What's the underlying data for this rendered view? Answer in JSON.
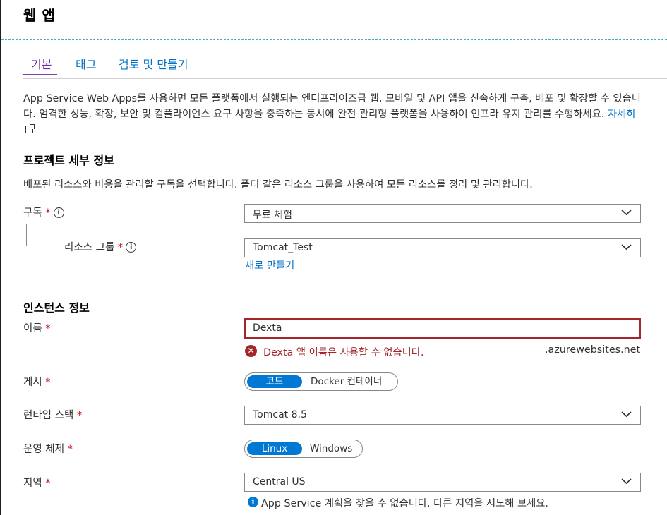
{
  "header": {
    "title": "웹 앱"
  },
  "tabs": [
    {
      "label": "기본",
      "active": true
    },
    {
      "label": "태그",
      "active": false
    },
    {
      "label": "검토 및 만들기",
      "active": false
    }
  ],
  "intro": {
    "text": "App Service Web Apps를 사용하면 모든 플랫폼에서 실행되는 엔터프라이즈급 웹, 모바일 및 API 앱을 신속하게 구축, 배포 및 확장할 수 있습니다. 엄격한 성능, 확장, 보안 및 컴플라이언스 요구 사항을 충족하는 동시에 완전 관리형 플랫폼을 사용하여 인프라 유지 관리를 수행하세요.",
    "learn_more": "자세히"
  },
  "project": {
    "title": "프로젝트 세부 정보",
    "description": "배포된 리소스와 비용을 관리할 구독을 선택합니다. 폴더 같은 리소스 그룹을 사용하여 모든 리소스를 정리 및 관리합니다.",
    "subscription_label": "구독",
    "subscription_value": "무료 체험",
    "resource_group_label": "리소스 그룹",
    "resource_group_value": "Tomcat_Test",
    "create_new": "새로 만들기"
  },
  "instance": {
    "title": "인스턴스 정보",
    "name_label": "이름",
    "name_value": "Dexta",
    "name_error": "Dexta 앱 이름은 사용할 수 없습니다.",
    "domain_suffix": ".azurewebsites.net",
    "publish_label": "게시",
    "publish_options": [
      "코드",
      "Docker 컨테이너"
    ],
    "runtime_label": "런타임 스택",
    "runtime_value": "Tomcat 8.5",
    "os_label": "운영 체제",
    "os_options": [
      "Linux",
      "Windows"
    ],
    "region_label": "지역",
    "region_value": "Central US",
    "region_hint": "App Service 계획을 찾을 수 없습니다. 다른 지역을 시도해 보세요."
  },
  "common": {
    "required_mark": "*",
    "info_glyph": "i",
    "error_glyph": "✕"
  },
  "colors": {
    "accent": "#0078d4",
    "link": "#0072c6",
    "error": "#a4262c",
    "active_tab": "#8a3bb8"
  }
}
